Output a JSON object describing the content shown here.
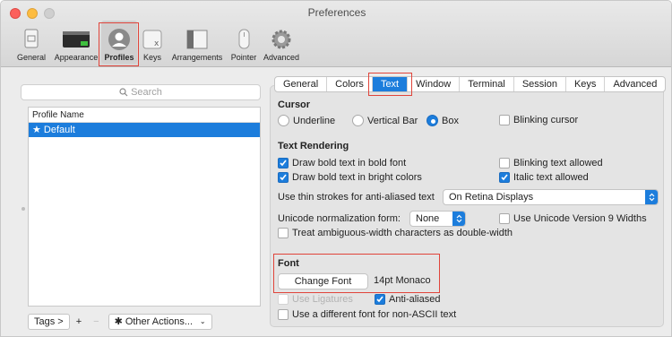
{
  "window": {
    "title": "Preferences"
  },
  "toolbar": {
    "items": [
      {
        "label": "General",
        "icon": "general-icon"
      },
      {
        "label": "Appearance",
        "icon": "appearance-icon"
      },
      {
        "label": "Profiles",
        "icon": "profiles-icon"
      },
      {
        "label": "Keys",
        "icon": "keys-icon"
      },
      {
        "label": "Arrangements",
        "icon": "arrangements-icon"
      },
      {
        "label": "Pointer",
        "icon": "pointer-icon"
      },
      {
        "label": "Advanced",
        "icon": "gear-icon"
      }
    ],
    "selected": "Profiles"
  },
  "sidebar": {
    "search_placeholder": "Search",
    "column_header": "Profile Name",
    "profiles": [
      {
        "name": "★ Default",
        "selected": true
      }
    ],
    "tags_button": "Tags >",
    "add_button": "+",
    "remove_button": "−",
    "other_actions": "Other Actions..."
  },
  "tabs": {
    "items": [
      "General",
      "Colors",
      "Text",
      "Window",
      "Terminal",
      "Session",
      "Keys",
      "Advanced"
    ],
    "active": "Text"
  },
  "cursor": {
    "title": "Cursor",
    "underline": "Underline",
    "vertical_bar": "Vertical Bar",
    "box": "Box",
    "blinking": "Blinking cursor",
    "selected": "Box"
  },
  "text_rendering": {
    "title": "Text Rendering",
    "bold_font": "Draw bold text in bold font",
    "bold_bright": "Draw bold text in bright colors",
    "blinking_allowed": "Blinking text allowed",
    "italic_allowed": "Italic text allowed",
    "thin_strokes_label": "Use thin strokes for anti-aliased text",
    "thin_strokes_value": "On Retina Displays",
    "unicode_norm_label": "Unicode normalization form:",
    "unicode_norm_value": "None",
    "unicode_v9": "Use Unicode Version 9 Widths",
    "ambiguous_width": "Treat ambiguous-width characters as double-width"
  },
  "font": {
    "title": "Font",
    "change_button": "Change Font",
    "current": "14pt Monaco",
    "ligatures": "Use Ligatures",
    "anti_aliased": "Anti-aliased",
    "non_ascii": "Use a different font for non-ASCII text"
  },
  "colors": {
    "accent": "#1c7ddc",
    "highlight": "#e0443a"
  }
}
